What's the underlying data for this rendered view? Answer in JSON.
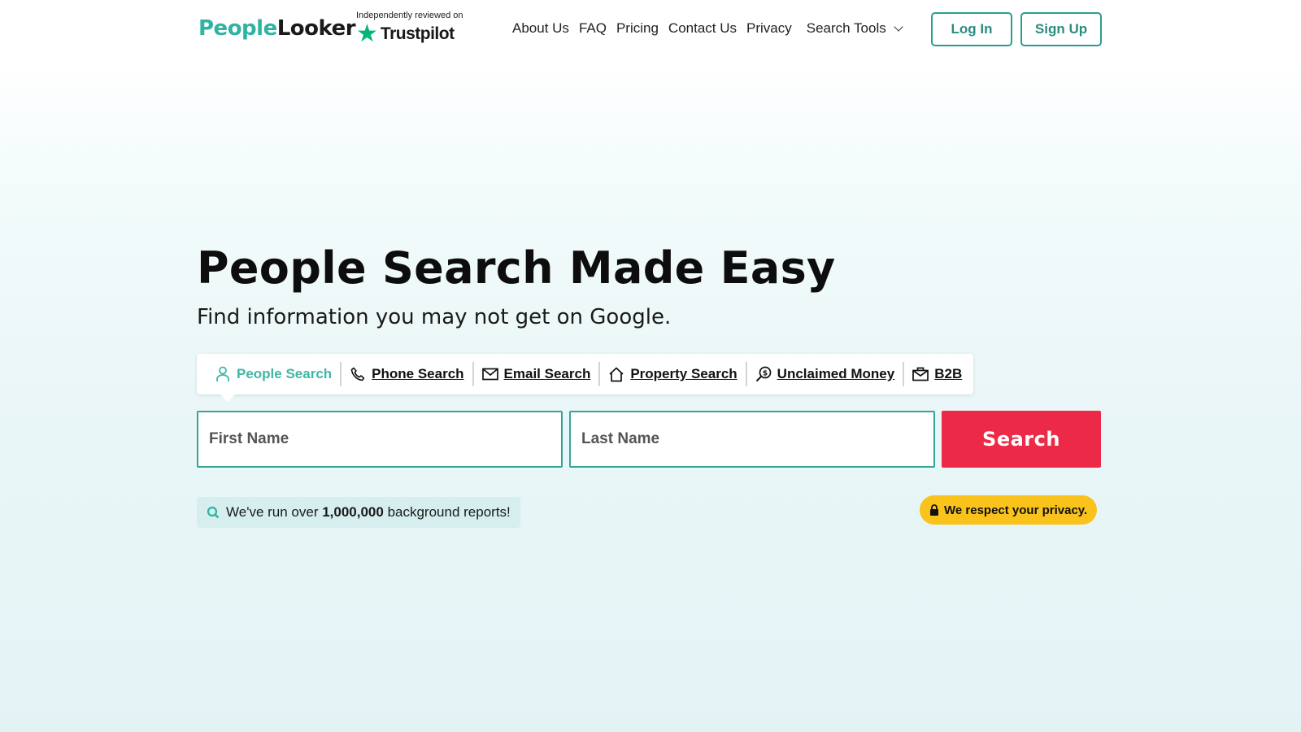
{
  "brand": {
    "logo_part1": "People",
    "logo_part2": "Looker",
    "trustpilot_small": "Independently reviewed on",
    "trustpilot_name": "Trustpilot"
  },
  "nav": {
    "items": [
      "About Us",
      "FAQ",
      "Pricing",
      "Contact Us",
      "Privacy"
    ],
    "tools_label": "Search Tools",
    "login_label": "Log In",
    "signup_label": "Sign Up"
  },
  "hero": {
    "title": "People Search Made Easy",
    "subtitle": "Find information you may not get on Google."
  },
  "tabs": [
    {
      "label": "People Search",
      "icon": "person-icon",
      "active": true
    },
    {
      "label": "Phone Search",
      "icon": "phone-icon",
      "active": false
    },
    {
      "label": "Email Search",
      "icon": "envelope-icon",
      "active": false
    },
    {
      "label": "Property Search",
      "icon": "house-icon",
      "active": false
    },
    {
      "label": "Unclaimed Money",
      "icon": "money-search-icon",
      "active": false
    },
    {
      "label": "B2B",
      "icon": "briefcase-icon",
      "active": false
    }
  ],
  "form": {
    "first_name_placeholder": "First Name",
    "last_name_placeholder": "Last Name",
    "search_label": "Search"
  },
  "badges": {
    "reports_prefix": "We've run over ",
    "reports_count": "1,000,000",
    "reports_suffix": " background reports!",
    "privacy": "We respect your privacy."
  },
  "colors": {
    "accent_teal": "#2fb3a3",
    "search_red": "#ec2a48",
    "privacy_yellow": "#f9c31c"
  }
}
